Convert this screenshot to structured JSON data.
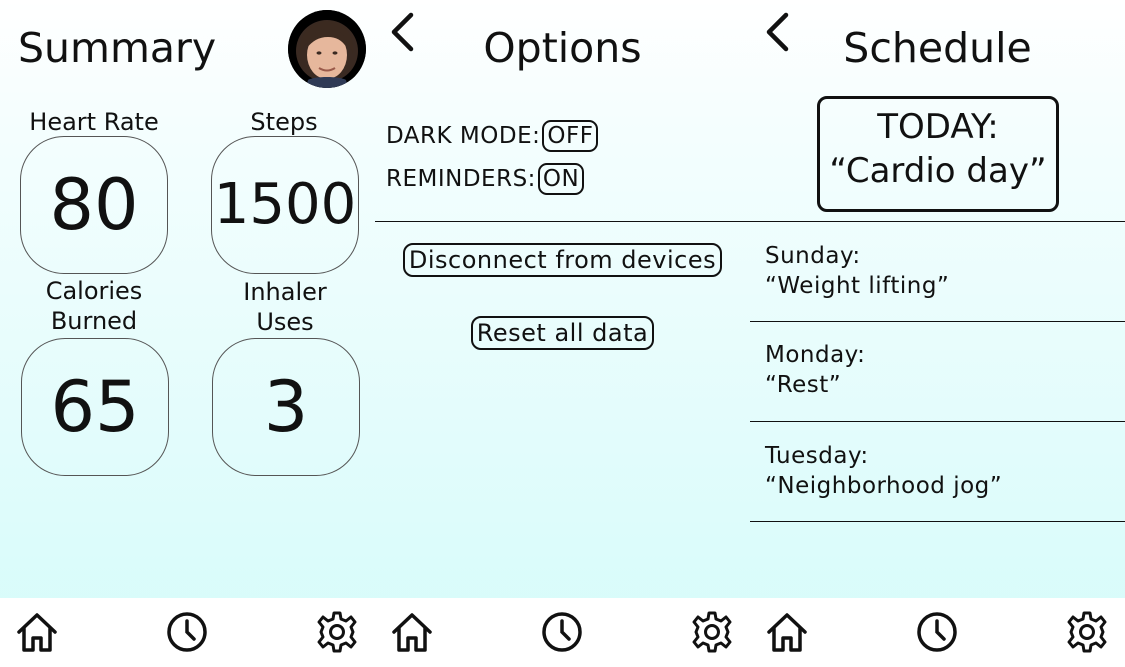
{
  "summary": {
    "title": "Summary",
    "stats": {
      "heart_rate": {
        "label": "Heart Rate",
        "value": "80"
      },
      "steps": {
        "label": "Steps",
        "value": "1500"
      },
      "calories": {
        "label_line1": "Calories",
        "label_line2": "Burned",
        "value": "65"
      },
      "inhaler": {
        "label_line1": "Inhaler",
        "label_line2": "Uses",
        "value": "3"
      }
    }
  },
  "options": {
    "title": "Options",
    "dark_mode": {
      "label": "DARK MODE:",
      "value": "OFF"
    },
    "reminders": {
      "label": "REMINDERS:",
      "value": "ON"
    },
    "disconnect_label": "Disconnect from devices",
    "reset_label": "Reset all data"
  },
  "schedule": {
    "title": "Schedule",
    "today_line1": "TODAY:",
    "today_line2": "“Cardio day”",
    "items": [
      {
        "day": "Sunday:",
        "activity": "“Weight lifting”"
      },
      {
        "day": "Monday:",
        "activity": "“Rest”"
      },
      {
        "day": "Tuesday:",
        "activity": "“Neighborhood jog”"
      }
    ]
  },
  "nav": {
    "icons": [
      "home-icon",
      "clock-icon",
      "gear-icon"
    ]
  },
  "colors": {
    "background_top": "#ffffff",
    "background_bottom": "#d5fbfa",
    "ink": "#111111"
  }
}
